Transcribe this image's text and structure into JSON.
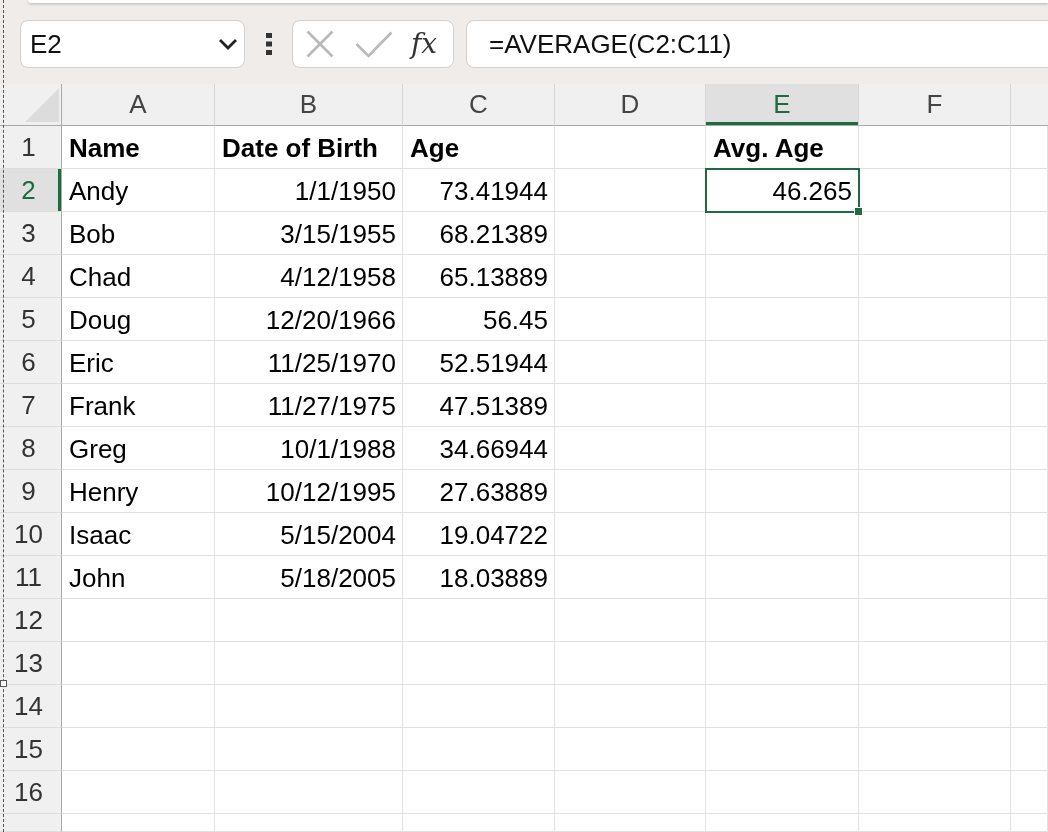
{
  "formula_bar": {
    "name_box": "E2",
    "function_label": "fx",
    "formula": "=AVERAGE(C2:C11)"
  },
  "sheet": {
    "columns": [
      {
        "label": "A",
        "selected": false
      },
      {
        "label": "B",
        "selected": false
      },
      {
        "label": "C",
        "selected": false
      },
      {
        "label": "D",
        "selected": false
      },
      {
        "label": "E",
        "selected": true
      },
      {
        "label": "F",
        "selected": false
      }
    ],
    "rows": [
      {
        "label": "1",
        "selected": false,
        "cells": [
          {
            "kind": "heading",
            "text": "Name",
            "selected": false
          },
          {
            "kind": "heading",
            "text": "Date of Birth",
            "selected": false
          },
          {
            "kind": "heading",
            "text": "Age",
            "selected": false
          },
          {
            "kind": "blank",
            "selected": false
          },
          {
            "kind": "heading",
            "text": "Avg. Age",
            "selected": false
          }
        ]
      },
      {
        "label": "2",
        "selected": true,
        "cells": [
          {
            "kind": "text",
            "text": "Andy",
            "selected": false
          },
          {
            "kind": "number",
            "text": "1/1/1950",
            "selected": false
          },
          {
            "kind": "number",
            "text": "73.41944",
            "selected": false
          },
          {
            "kind": "blank",
            "selected": false
          },
          {
            "kind": "number",
            "text": "46.265",
            "selected": true
          }
        ]
      },
      {
        "label": "3",
        "selected": false,
        "cells": [
          {
            "kind": "text",
            "text": "Bob",
            "selected": false
          },
          {
            "kind": "number",
            "text": "3/15/1955",
            "selected": false
          },
          {
            "kind": "number",
            "text": "68.21389",
            "selected": false
          }
        ]
      },
      {
        "label": "4",
        "selected": false,
        "cells": [
          {
            "kind": "text",
            "text": "Chad",
            "selected": false
          },
          {
            "kind": "number",
            "text": "4/12/1958",
            "selected": false
          },
          {
            "kind": "number",
            "text": "65.13889",
            "selected": false
          }
        ]
      },
      {
        "label": "5",
        "selected": false,
        "cells": [
          {
            "kind": "text",
            "text": "Doug",
            "selected": false
          },
          {
            "kind": "number",
            "text": "12/20/1966",
            "selected": false
          },
          {
            "kind": "number",
            "text": "56.45",
            "selected": false
          }
        ]
      },
      {
        "label": "6",
        "selected": false,
        "cells": [
          {
            "kind": "text",
            "text": "Eric",
            "selected": false
          },
          {
            "kind": "number",
            "text": "11/25/1970",
            "selected": false
          },
          {
            "kind": "number",
            "text": "52.51944",
            "selected": false
          }
        ]
      },
      {
        "label": "7",
        "selected": false,
        "cells": [
          {
            "kind": "text",
            "text": "Frank",
            "selected": false
          },
          {
            "kind": "number",
            "text": "11/27/1975",
            "selected": false
          },
          {
            "kind": "number",
            "text": "47.51389",
            "selected": false
          }
        ]
      },
      {
        "label": "8",
        "selected": false,
        "cells": [
          {
            "kind": "text",
            "text": "Greg",
            "selected": false
          },
          {
            "kind": "number",
            "text": "10/1/1988",
            "selected": false
          },
          {
            "kind": "number",
            "text": "34.66944",
            "selected": false
          }
        ]
      },
      {
        "label": "9",
        "selected": false,
        "cells": [
          {
            "kind": "text",
            "text": "Henry",
            "selected": false
          },
          {
            "kind": "number",
            "text": "10/12/1995",
            "selected": false
          },
          {
            "kind": "number",
            "text": "27.63889",
            "selected": false
          }
        ]
      },
      {
        "label": "10",
        "selected": false,
        "cells": [
          {
            "kind": "text",
            "text": "Isaac",
            "selected": false
          },
          {
            "kind": "number",
            "text": "5/15/2004",
            "selected": false
          },
          {
            "kind": "number",
            "text": "19.04722",
            "selected": false
          }
        ]
      },
      {
        "label": "11",
        "selected": false,
        "cells": [
          {
            "kind": "text",
            "text": "John",
            "selected": false
          },
          {
            "kind": "number",
            "text": "5/18/2005",
            "selected": false
          },
          {
            "kind": "number",
            "text": "18.03889",
            "selected": false
          }
        ]
      },
      {
        "label": "12",
        "selected": false
      },
      {
        "label": "13",
        "selected": false
      },
      {
        "label": "14",
        "selected": false
      },
      {
        "label": "15",
        "selected": false
      },
      {
        "label": "16",
        "selected": false
      }
    ]
  }
}
